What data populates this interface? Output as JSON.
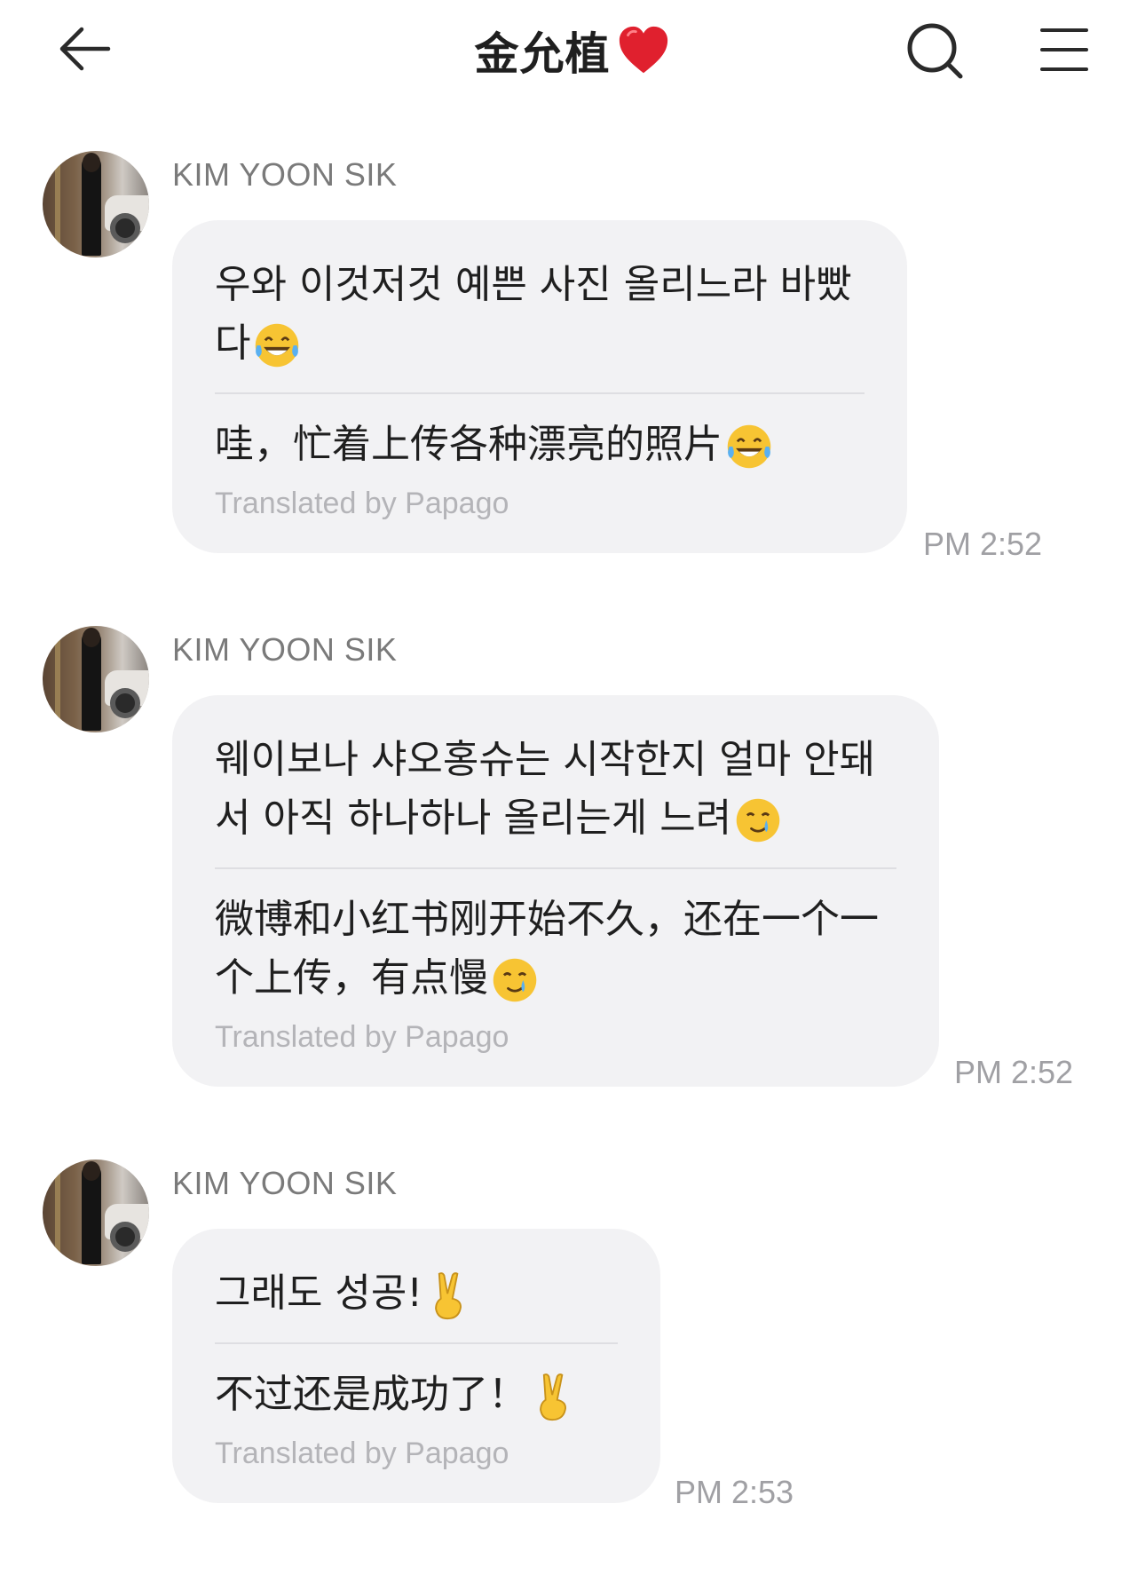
{
  "header": {
    "title": "金允植",
    "icons": [
      "back-arrow-icon",
      "heart-icon",
      "search-icon",
      "menu-icon"
    ]
  },
  "messages": [
    {
      "sender": "KIM YOON SIK",
      "original": "우와 이것저것 예쁜 사진 올리느라 바빴다",
      "original_emoji": "tears-of-joy-emoji",
      "translation": "哇，忙着上传各种漂亮的照片",
      "translation_emoji": "tears-of-joy-emoji",
      "credit": "Translated by Papago",
      "time": "PM 2:52"
    },
    {
      "sender": "KIM YOON SIK",
      "original": "웨이보나 샤오홍슈는 시작한지 얼마 안돼서 아직 하나하나 올리는게 느려",
      "original_emoji": "smiling-with-tear-emoji",
      "translation": "微博和小红书刚开始不久，还在一个一个上传，有点慢",
      "translation_emoji": "smiling-with-tear-emoji",
      "credit": "Translated by Papago",
      "time": "PM 2:52"
    },
    {
      "sender": "KIM YOON SIK",
      "original": "그래도 성공!",
      "original_emoji": "victory-hand-emoji",
      "translation": "不过还是成功了！",
      "translation_emoji": "victory-hand-emoji",
      "credit": "Translated by Papago",
      "time": "PM 2:53"
    }
  ],
  "colors": {
    "bubble": "#f2f2f4",
    "heart": "#e0202e",
    "sender": "#7a7a7a",
    "time": "#a0a0a4",
    "credit": "#b4b4b8"
  }
}
